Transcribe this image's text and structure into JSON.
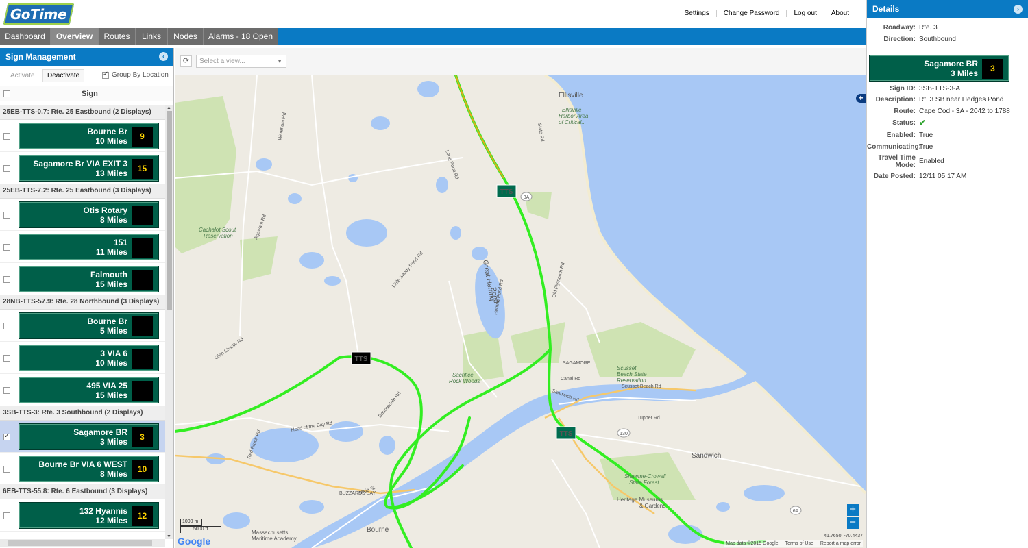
{
  "app": {
    "logo": "GoTime"
  },
  "top_links": [
    "Settings",
    "Change Password",
    "Log out",
    "About"
  ],
  "nav": [
    "Dashboard",
    "Overview",
    "Routes",
    "Links",
    "Nodes",
    "Alarms - 18 Open"
  ],
  "sidebar": {
    "title": "Sign Management",
    "activate": "Activate",
    "deactivate": "Deactivate",
    "group_by": "Group By Location",
    "column": "Sign",
    "groups": [
      {
        "label": "25EB-TTS-0.7: Rte. 25 Eastbound (2 Displays)",
        "signs": [
          {
            "l1": "Bourne Br",
            "l2": "10 Miles",
            "num": "9",
            "checked": false
          },
          {
            "l1": "Sagamore Br VIA EXIT 3",
            "l2": "13 Miles",
            "num": "15",
            "checked": false
          }
        ]
      },
      {
        "label": "25EB-TTS-7.2: Rte. 25 Eastbound (3 Displays)",
        "signs": [
          {
            "l1": "Otis Rotary",
            "l2": "8 Miles",
            "num": "",
            "checked": false
          },
          {
            "l1": "151",
            "l2": "11 Miles",
            "num": "",
            "checked": false
          },
          {
            "l1": "Falmouth",
            "l2": "15 Miles",
            "num": "",
            "checked": false
          }
        ]
      },
      {
        "label": "28NB-TTS-57.9: Rte. 28 Northbound (3 Displays)",
        "signs": [
          {
            "l1": "Bourne Br",
            "l2": "5 Miles",
            "num": "",
            "checked": false
          },
          {
            "l1": "3 VIA 6",
            "l2": "10 Miles",
            "num": "",
            "checked": false
          },
          {
            "l1": "495 VIA 25",
            "l2": "15 Miles",
            "num": "",
            "checked": false
          }
        ]
      },
      {
        "label": "3SB-TTS-3: Rte. 3 Southbound (2 Displays)",
        "signs": [
          {
            "l1": "Sagamore BR",
            "l2": "3 Miles",
            "num": "3",
            "checked": true
          },
          {
            "l1": "Bourne Br VIA 6 WEST",
            "l2": "8 Miles",
            "num": "10",
            "checked": false
          }
        ]
      },
      {
        "label": "6EB-TTS-55.8: Rte. 6 Eastbound (3 Displays)",
        "signs": [
          {
            "l1": "132 Hyannis",
            "l2": "12 Miles",
            "num": "12",
            "checked": false
          }
        ]
      }
    ]
  },
  "map": {
    "view_placeholder": "Select a view...",
    "tts_label": "TTS",
    "scale_m": "1000 m",
    "scale_ft": "5000 ft",
    "google": "Google",
    "coords": "41.7650, -70.4437",
    "attrib": [
      "Map data ©2015 Google",
      "Terms of Use",
      "Report a map error"
    ],
    "labels": {
      "ellisville": "Ellisville",
      "ellisville_harbor": "Ellisville",
      "ellisville_harbor2": "Harbor Area",
      "ellisville_harbor3": "of Critical...",
      "great_herring": "Great Herring",
      "pond": "Pond",
      "sagamore": "SAGAMORE",
      "scusset": "Scusset",
      "scusset2": "Beach State",
      "scusset3": "Reservation",
      "sacrifice": "Sacrifice",
      "sacrifice2": "Rock Woods",
      "sandwich": "Sandwich",
      "shawme": "Shawme-Crowell",
      "shawme2": "State Forest",
      "heritage": "Heritage Museums",
      "heritage2": "& Gardens",
      "buzzards": "BUZZARDS BAY",
      "mass_maritime": "Massachusetts",
      "mass_maritime2": "Maritime Academy",
      "bourne": "Bourne",
      "cachalot": "Cachalot Scout",
      "cachalot2": "Reservation",
      "canal_rd": "Canal Rd",
      "scusset_beach_rd": "Scusset Beach Rd",
      "state_rd": "State Rd",
      "sandwich_rd": "Sandwich Rd",
      "tupper_rd": "Tupper Rd",
      "head_bay": "Head of the Bay Rd",
      "main_st": "Main St",
      "red_brook": "Red Brook Rd",
      "old_plymouth": "Old Plymouth Rd",
      "herring_pond": "Herring Pond Rd",
      "bournedale": "Bournedale Rd",
      "glen_charlie": "Glen Charlie Rd",
      "long_pond": "Long Pond Rd",
      "little_sandy": "Little Sandy Pond Rd",
      "wareham_rd": "Wareham Rd",
      "agawam_rd": "Agawam Rd",
      "route_3a": "3A",
      "route_6a": "6A",
      "route_130": "130"
    }
  },
  "details": {
    "title": "Details",
    "roadway_k": "Roadway:",
    "roadway_v": "Rte. 3",
    "direction_k": "Direction:",
    "direction_v": "Southbound",
    "sign": {
      "l1": "Sagamore BR",
      "l2": "3 Miles",
      "num": "3"
    },
    "sign_id_k": "Sign ID:",
    "sign_id_v": "3SB-TTS-3-A",
    "desc_k": "Description:",
    "desc_v": "Rt. 3 SB near Hedges Pond",
    "route_k": "Route:",
    "route_v": "Cape Cod - 3A - 2042 to 1788",
    "status_k": "Status:",
    "status_v": "✔",
    "enabled_k": "Enabled:",
    "enabled_v": "True",
    "comm_k": "Communicating:",
    "comm_v": "True",
    "ttm_k1": "Travel Time",
    "ttm_k2": "Mode:",
    "ttm_v": "Enabled",
    "posted_k": "Date Posted:",
    "posted_v": "12/11 05:17 AM"
  },
  "colors": {
    "brand_blue": "#0a7ac4",
    "sign_green": "#005f49",
    "sign_number": "#ffd400",
    "traffic_green": "#33ee22",
    "water": "#a8c8f5"
  }
}
